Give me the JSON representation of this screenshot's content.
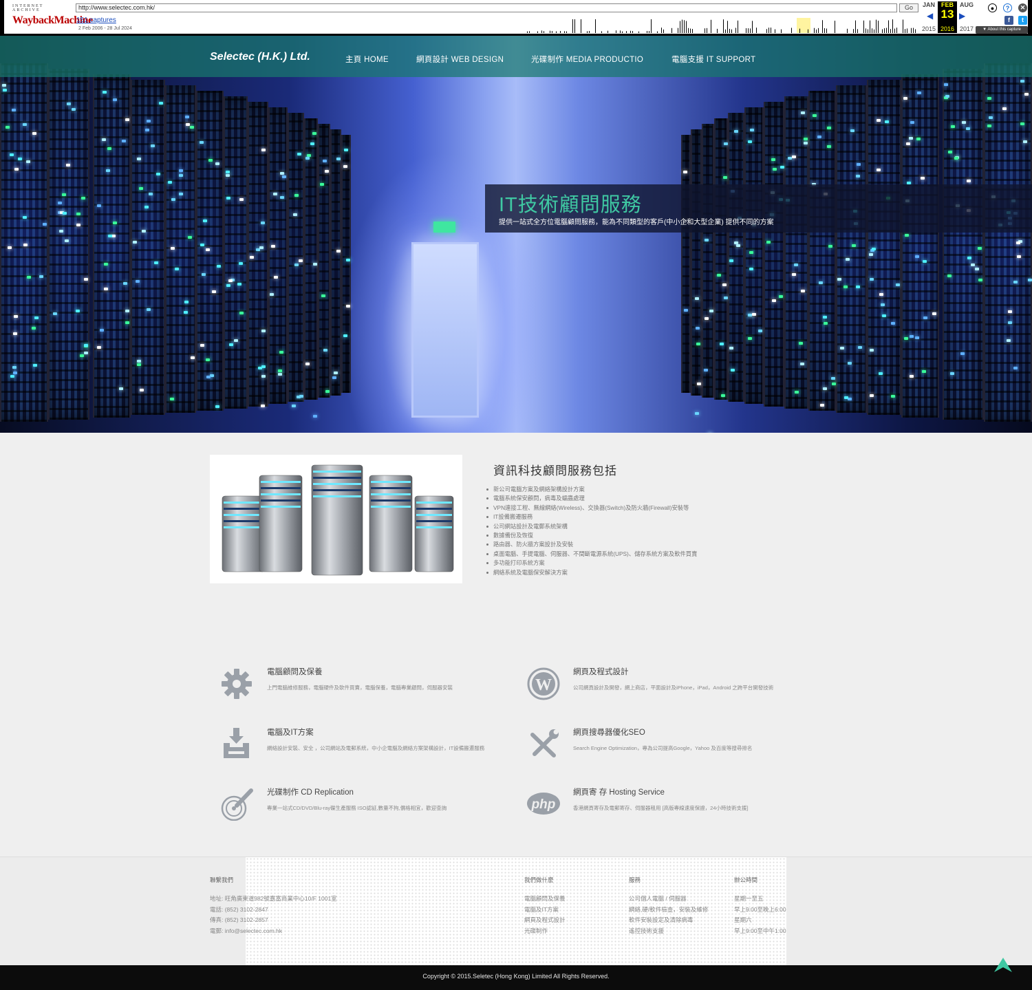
{
  "wayback": {
    "ia_label": "INTERNET ARCHIVE",
    "logo_text": "WaybackMachine",
    "url": "http://www.selectec.com.hk/",
    "go_label": "Go",
    "captures": "151 captures",
    "date_range": "2 Feb 2006 - 28 Jul 2024",
    "prev_month": "JAN",
    "cur_month": "FEB",
    "next_month": "AUG",
    "cur_day": "13",
    "prev_year": "2015",
    "cur_year": "2016",
    "next_year": "2017",
    "about_label": "▼ About this capture",
    "icons": [
      "user-icon",
      "help-icon",
      "close-icon",
      "facebook-icon",
      "twitter-icon"
    ]
  },
  "nav": {
    "brand": "Selectec (H.K.) Ltd.",
    "items": [
      "主頁 HOME",
      "網頁設計 WEB DESIGN",
      "光碟制作 MEDIA PRODUCTIO",
      "電腦支援 IT SUPPORT"
    ]
  },
  "hero": {
    "title": "IT技術顧問服務",
    "subtitle": "提供一站式全方位電腦顧問服務，能為不同類型的客戶(中小企和大型企業) 提供不同的方案"
  },
  "services": {
    "heading": "資訊科技顧問服務包括",
    "items": [
      "新公司電腦方案及網絡架構設計方案",
      "電腦系統保安顧問，病毒及蠕蟲處理",
      "VPN連接工程、無線網絡(Wireless)、交換器(Switch)及防火牆(Firewall)安裝等",
      "IT設備搬遷服務",
      "公司網站設計及電郵系統架構",
      "數據備份及恢復",
      "路由器、防火牆方案設計及安裝",
      "桌面電腦、手提電腦、伺服器、不間斷電源系統(UPS)、儲存系統方案及軟件買賣",
      "多功能打印系統方案",
      "網絡系統及電腦保安解決方案"
    ]
  },
  "features": [
    {
      "icon": "gear-icon",
      "title": "電腦顧問及保養",
      "desc": "上門電腦維修服務，電腦硬件及軟件買賣，電腦保養，電腦專業顧問，伺服器安裝"
    },
    {
      "icon": "wordpress-icon",
      "title": "網頁及程式設計",
      "desc": "公司網頁設計及開發，網上商店，平面設計及iPhone，iPad，Android 之跨平台開發技術"
    },
    {
      "icon": "download-tray-icon",
      "title": "電腦及IT方案",
      "desc": "網絡設計安裝、安全 ，公司網站及電郵系統，中小企電腦及網絡方案架構設計，IT設備搬遷服務"
    },
    {
      "icon": "tools-icon",
      "title": "網頁搜尋器優化SEO",
      "desc": "Search Engine Optimization，專為公司提高Google，Yahoo 及百度等搜尋排名"
    },
    {
      "icon": "cd-pen-icon",
      "title": "光碟制作 CD Replication",
      "desc": "專業一站式CD/DVD/Blu-ray碟生產服務 ISO認証,數量不拘,價格相宜，歡迎查詢"
    },
    {
      "icon": "php-icon",
      "title": "網頁寄 存 Hosting Service",
      "desc": "香港網頁寄存及電郵寄存、伺服器租用 [高版專線速度保證，24小時技術支援]"
    }
  ],
  "footer": {
    "contact": {
      "heading": "聯繫我們",
      "lines": [
        "地址: 旺角廣東道982號嘉富商業中心10/F 1001室",
        "電話: (852) 3102-2847",
        "傳真: (852) 3102-2857",
        "電郵: info@selectec.com.hk"
      ]
    },
    "what": {
      "heading": "我們做什麼",
      "lines": [
        "電腦顧問及保養",
        "電腦及IT方案",
        "網頁及程式設計",
        "光碟制作"
      ]
    },
    "service": {
      "heading": "服務",
      "lines": [
        "公司個人電腦 / 伺服器",
        "網絡,硬/軟件檢查，安裝及維修",
        "軟件安裝設定及清除病毒",
        "遙控技術支援"
      ]
    },
    "hours": {
      "heading": "辦公時間",
      "lines": [
        "星期一至五",
        "早上9:00至晚上6:00",
        "星期六",
        "早上9:00至中午1:00"
      ]
    },
    "copyright": "Copyright © 2015.Seletec (Hong Kong) Limited All Rights Reserved."
  },
  "colors": {
    "accent": "#3fc8a2",
    "nav_bg": "#19786e",
    "icon_gray": "#9aa0a8",
    "footer_dark": "#0c0c0c"
  }
}
